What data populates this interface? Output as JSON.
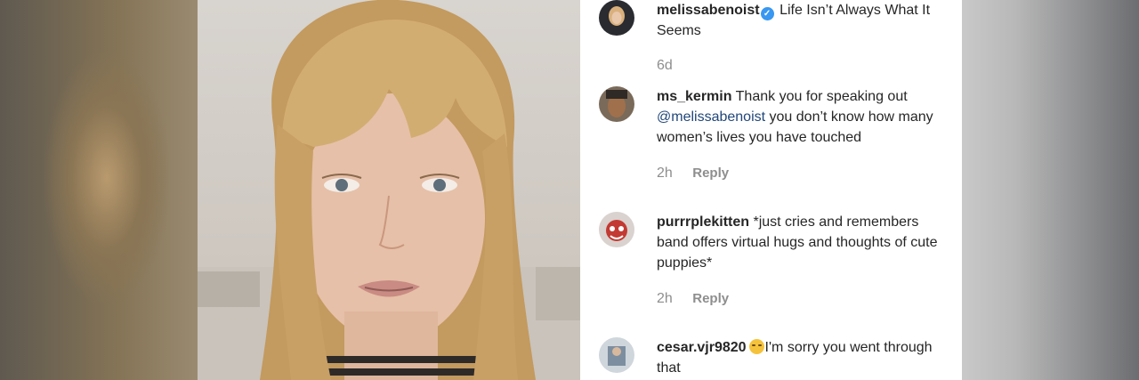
{
  "post": {
    "username": "melissabenoist",
    "caption": "Life Isn’t Always What It Seems",
    "time": "6d"
  },
  "comments": [
    {
      "username": "ms_kermin",
      "text_before": "Thank you for speaking out",
      "mention": "@melissabenoist",
      "text_after": "you don’t know how many women’s lives you have touched",
      "time": "2h",
      "reply_label": "Reply"
    },
    {
      "username": "purrrplekitten",
      "text": "*just cries and remembers band offers virtual hugs and thoughts of cute puppies*",
      "time": "2h",
      "reply_label": "Reply"
    },
    {
      "username": "cesar.vjr9820",
      "emoji": "crying-laughing-face",
      "text": "I'm sorry you went through that"
    }
  ],
  "colors": {
    "verified": "#3897f0",
    "mention": "#22477a",
    "meta_gray": "#8e8e8e"
  }
}
